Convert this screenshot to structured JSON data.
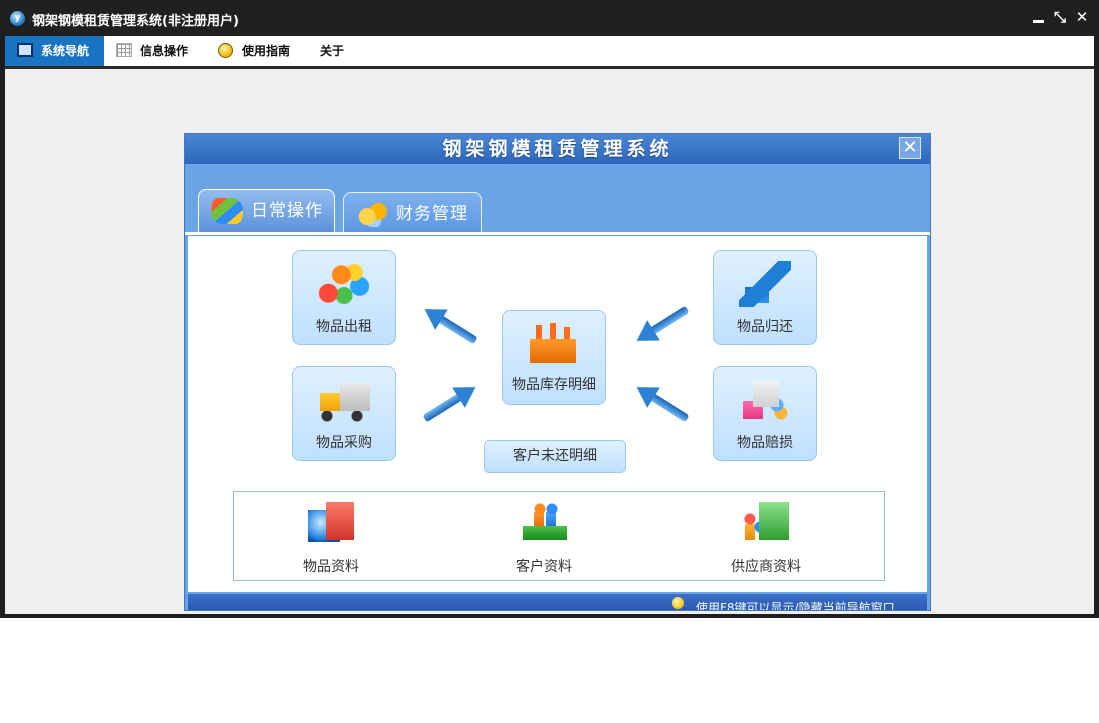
{
  "window": {
    "title": "钢架钢模租赁管理系统(非注册用户)",
    "logo_letter": "y",
    "controls": {
      "restore": "⤡",
      "close": "✕"
    }
  },
  "menu": [
    {
      "label": "系统导航",
      "icon": "monitor-icon",
      "active": true
    },
    {
      "label": "信息操作",
      "icon": "grid-icon",
      "active": false
    },
    {
      "label": "使用指南",
      "icon": "bulb-icon",
      "active": false
    },
    {
      "label": "关于",
      "icon": "",
      "active": false
    }
  ],
  "panel": {
    "title": "钢架钢模租赁管理系统",
    "close_glyph": "✕",
    "tabs": [
      {
        "label": "日常操作",
        "icon": "windows-flag-icon",
        "active": true
      },
      {
        "label": "财务管理",
        "icon": "coins-icon",
        "active": false
      }
    ],
    "tiles": {
      "rent_out": {
        "label": "物品出租",
        "icon": "blocks-icon"
      },
      "purchase": {
        "label": "物品采购",
        "icon": "truck-icon"
      },
      "inventory": {
        "label": "物品库存明细",
        "icon": "factory-icon"
      },
      "return": {
        "label": "物品归还",
        "icon": "return-arrow-icon"
      },
      "damage": {
        "label": "物品赔损",
        "icon": "gift-box-icon"
      },
      "unreturned": {
        "label": "客户未还明细"
      }
    },
    "resources": [
      {
        "label": "物品资料",
        "icon": "globe-folder-icon"
      },
      {
        "label": "客户资料",
        "icon": "people-book-icon"
      },
      {
        "label": "供应商资料",
        "icon": "people-folder-icon"
      }
    ],
    "status_text": "使用F8键可以显示/隐藏当前导航窗口"
  },
  "colors": {
    "titlebar": "#202020",
    "active_menu": "#1a74c4",
    "panel_blue": "#6aa4e2",
    "tile_fill": "#cfe7ff"
  }
}
